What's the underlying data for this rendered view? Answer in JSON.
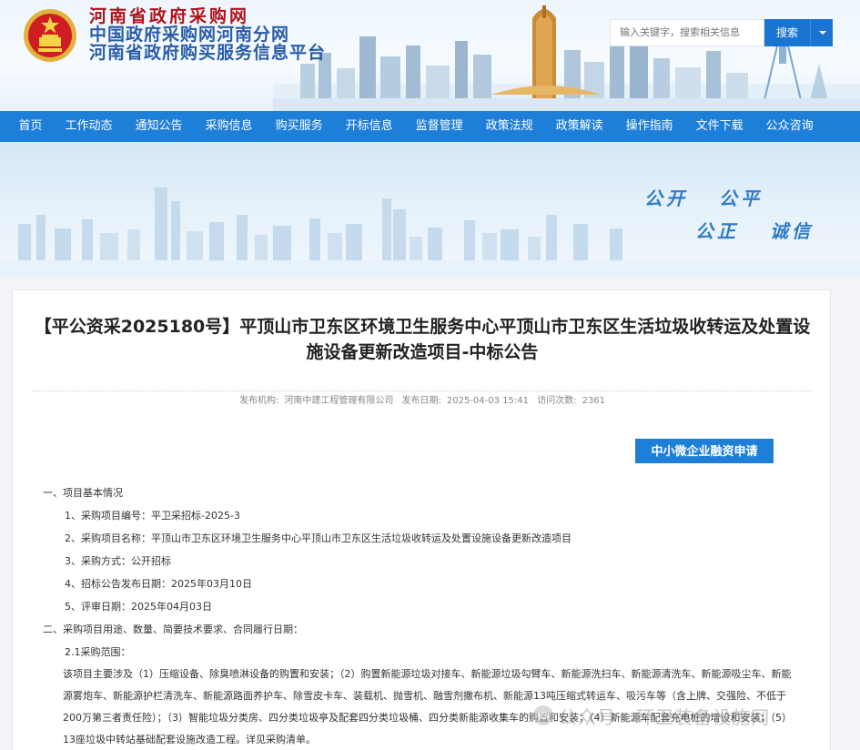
{
  "header": {
    "titles": [
      "河南省政府采购网",
      "中国政府采购网河南分网",
      "河南省政府购买服务信息平台"
    ],
    "search_placeholder": "输入关键字，搜索相关信息",
    "search_label": "搜索"
  },
  "nav": {
    "items": [
      "首页",
      "工作动态",
      "通知公告",
      "采购信息",
      "购买服务",
      "开标信息",
      "监督管理",
      "政策法规",
      "政策解读",
      "操作指南",
      "文件下载",
      "公众咨询"
    ]
  },
  "banner": {
    "slogans": [
      "公开",
      "公平",
      "公正",
      "诚信"
    ]
  },
  "article": {
    "title": "【平公资采2025180号】平顶山市卫东区环境卫生服务中心平顶山市卫东区生活垃圾收转运及处置设施设备更新改造项目-中标公告",
    "meta": {
      "publisher_label": "发布机构:",
      "publisher": "河南中建工程管理有限公司",
      "date_label": "发布日期:",
      "date": "2025-04-03 15:41",
      "views_label": "访问次数:",
      "views": "2361"
    },
    "finance_button": "中小微企业融资申请",
    "lines": [
      "一、项目基本情况",
      "1、采购项目编号：平卫采招标-2025-3",
      "2、采购项目名称：平顶山市卫东区环境卫生服务中心平顶山市卫东区生活垃圾收转运及处置设施设备更新改造项目",
      "3、采购方式：公开招标",
      "4、招标公告发布日期：2025年03月10日",
      "5、评审日期：2025年04月03日",
      "二、采购项目用途、数量、简要技术要求、合同履行日期：",
      "2.1采购范围："
    ],
    "paragraph": "该项目主要涉及（1）压缩设备、除臭喷淋设备的购置和安装；（2）购置新能源垃圾对接车、新能源垃圾勾臂车、新能源洗扫车、新能源清洗车、新能源吸尘车、新能源雾炮车、新能源护栏清洗车、新能源路面养护车、除雪皮卡车、装载机、抛雪机、融雪剂撒布机、新能源13吨压缩式转运车、吸污车等（含上牌、交强险、不低于200万第三者责任险）；（3）智能垃圾分类房、四分类垃圾亭及配套四分类垃圾桶、四分类新能源收集车的购置和安装；（4）新能源车配套充电桩的增设和安装；（5）13座垃圾中转站基础配套设施改造工程。详见采购清单。"
  },
  "watermark": {
    "text": "公众号 · 环卫装备设施网"
  },
  "colors": {
    "nav": "#1e7fd8",
    "title_red": "#b0121b",
    "title_blue": "#2a5ca8",
    "button": "#1a74d2"
  }
}
